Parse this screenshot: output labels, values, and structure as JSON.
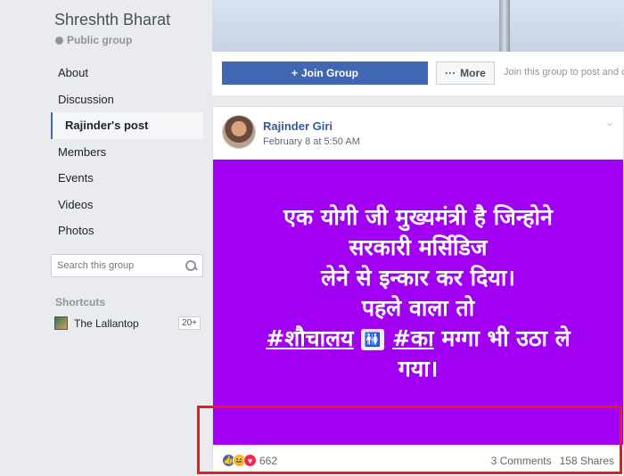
{
  "group": {
    "name": "Shreshth Bharat",
    "type": "Public group"
  },
  "nav": {
    "items": [
      {
        "label": "About"
      },
      {
        "label": "Discussion"
      },
      {
        "label": "Rajinder's post"
      },
      {
        "label": "Members"
      },
      {
        "label": "Events"
      },
      {
        "label": "Videos"
      },
      {
        "label": "Photos"
      }
    ],
    "active_index": 2
  },
  "search": {
    "placeholder": "Search this group"
  },
  "shortcuts": {
    "label": "Shortcuts",
    "items": [
      {
        "name": "The Lallantop",
        "count": "20+"
      }
    ]
  },
  "actions": {
    "join_label": "Join Group",
    "more_label": "More",
    "join_hint": "Join this group to post and c"
  },
  "post": {
    "author": "Rajinder Giri",
    "time": "February 8 at 5:50 AM",
    "text_lines": [
      "एक योगी जी मुख्यमंत्री है जिन्होने",
      "सरकारी मर्सिडिज",
      "लेने से इन्कार कर दिया।",
      "पहले वाला तो"
    ],
    "tag1": "#शौचालय",
    "tag2": "#का",
    "text_tail": "मग्गा भी उठा ले",
    "text_end": "गया।",
    "background_color": "#a100f3",
    "reaction_count": "662",
    "comments": "3 Comments",
    "shares": "158 Shares"
  },
  "highlight_color": "#e81c1c"
}
